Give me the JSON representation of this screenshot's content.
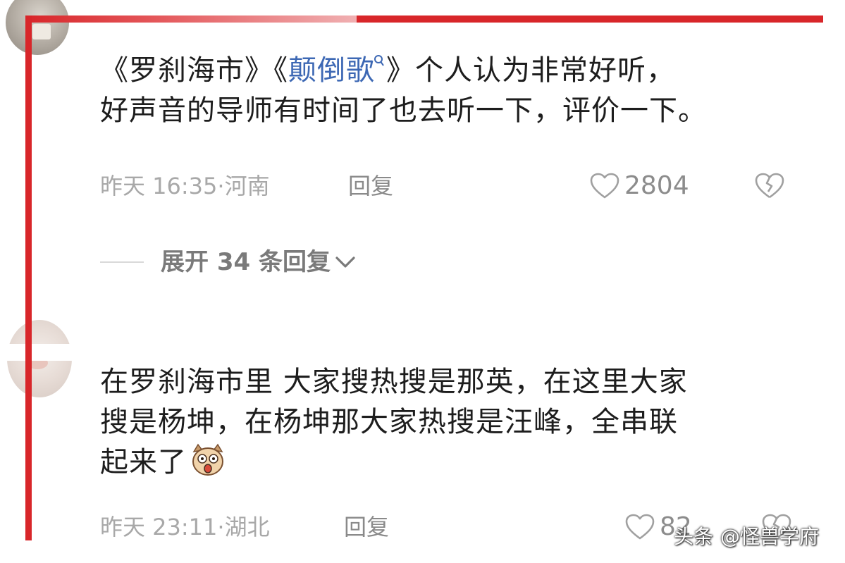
{
  "comments": [
    {
      "text_before": "《罗刹海市》《",
      "link_text": "颠倒歌",
      "text_after": "》个人认为非常好听，",
      "line2": "好声音的导师有时间了也去听一下，评价一下。",
      "time": "昨天 16:35",
      "separator": "·",
      "location": "河南",
      "reply_label": "回复",
      "likes": "2804",
      "expand_label": "展开 34 条回复"
    },
    {
      "line1": "在罗刹海市里 大家搜热搜是那英，在这里大家",
      "line2": "搜是杨坤，在杨坤那大家热搜是汪峰，全串联",
      "line3": "起来了",
      "time": "昨天 23:11",
      "separator": "·",
      "location": "湖北",
      "reply_label": "回复",
      "likes": "82"
    }
  ],
  "watermark": {
    "platform": "头条",
    "handle": "@怪兽学府"
  },
  "icons": {
    "like": "heart-outline-icon",
    "dislike": "broken-heart-icon",
    "expand": "chevron-down-icon",
    "search": "search-icon",
    "emoji": "surprised-dog-emoji-icon"
  },
  "colors": {
    "annotation": "#d8262a",
    "link": "#3d68b4",
    "body_text": "#1d1d1d",
    "meta_text": "#a8a8a8"
  }
}
